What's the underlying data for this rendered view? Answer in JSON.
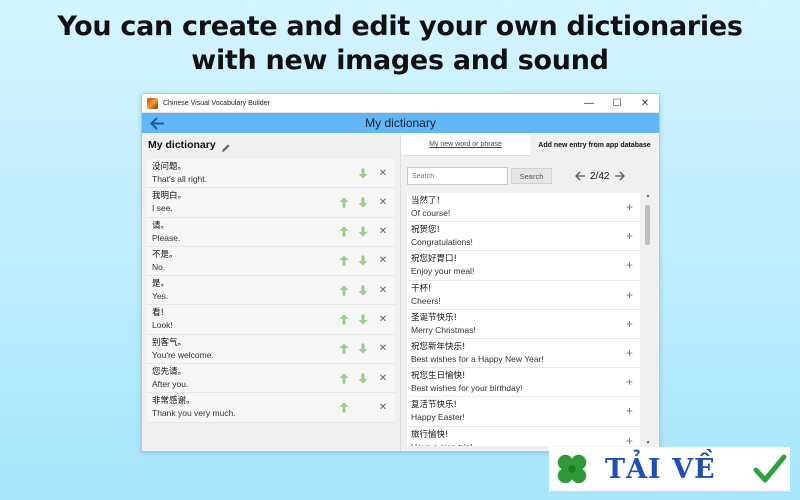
{
  "headline": {
    "line1": "You can create and edit your own dictionaries",
    "line2": "with new images and sound"
  },
  "window": {
    "title": "Chinese Visual Vocabulary Builder",
    "controls": {
      "minimize": "—",
      "maximize": "☐",
      "close": "✕"
    },
    "appbar_title": "My dictionary",
    "icons": {
      "back": "arrow-left-icon",
      "edit": "pencil-icon"
    }
  },
  "left": {
    "title": "My dictionary",
    "entries": [
      {
        "zh": "没问题。",
        "en": "That's all right.",
        "up": false
      },
      {
        "zh": "我明白。",
        "en": "I see.",
        "up": true
      },
      {
        "zh": "请。",
        "en": "Please.",
        "up": true
      },
      {
        "zh": "不是。",
        "en": "No.",
        "up": true
      },
      {
        "zh": "是。",
        "en": "Yes.",
        "up": true
      },
      {
        "zh": "看!",
        "en": "Look!",
        "up": true
      },
      {
        "zh": "别客气。",
        "en": "You're welcome.",
        "up": true
      },
      {
        "zh": "您先请。",
        "en": "After you.",
        "up": true
      },
      {
        "zh": "非常感谢。",
        "en": "Thank you very much.",
        "up": true
      }
    ],
    "controls": {
      "up": "↑",
      "down": "↓",
      "delete": "✕"
    }
  },
  "right": {
    "tabs": {
      "new_word": "My new word or phrase",
      "add_from_db": "Add new entry from app database"
    },
    "search": {
      "placeholder": "Search",
      "button": "Search"
    },
    "pager": {
      "text": "2/42"
    },
    "items": [
      {
        "zh": "当然了!",
        "en": "Of course!"
      },
      {
        "zh": "祝贺您!",
        "en": "Congratulations!"
      },
      {
        "zh": "祝您好胃口!",
        "en": "Enjoy your meal!"
      },
      {
        "zh": "干杯!",
        "en": "Cheers!"
      },
      {
        "zh": "圣诞节快乐!",
        "en": "Merry Christmas!"
      },
      {
        "zh": "祝您新年快乐!",
        "en": "Best wishes for a Happy New Year!"
      },
      {
        "zh": "祝您生日愉快!",
        "en": "Best wishes for your birthday!"
      },
      {
        "zh": "复活节快乐!",
        "en": "Happy Easter!"
      },
      {
        "zh": "旅行愉快!",
        "en": "Have a nice trip!"
      }
    ],
    "plus": "+"
  },
  "badge": {
    "text": "TẢI VỀ"
  },
  "colors": {
    "appbar": "#63b6f5",
    "arrow_green": "#9ccc8c",
    "badge_blue": "#1f4fb3",
    "check_green": "#2da23b"
  }
}
